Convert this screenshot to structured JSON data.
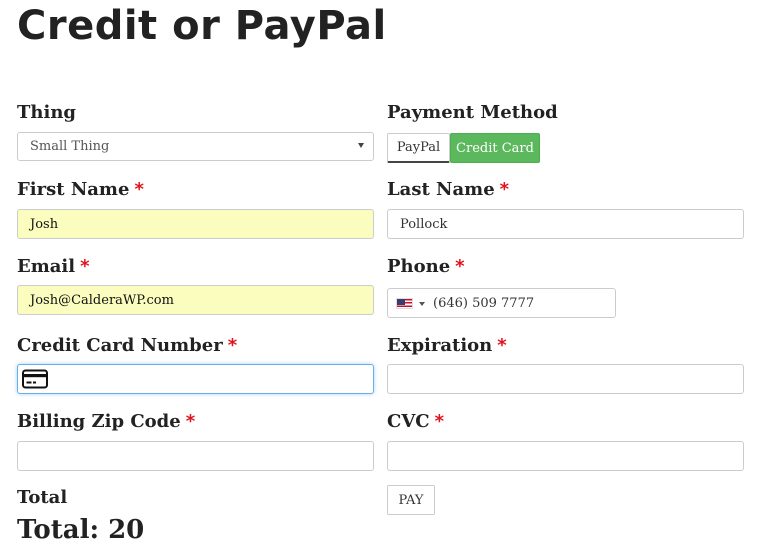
{
  "page": {
    "title": "Credit or PayPal"
  },
  "form": {
    "thing": {
      "label": "Thing",
      "selected": "Small Thing"
    },
    "payment_method": {
      "label": "Payment Method",
      "options": [
        "PayPal",
        "Credit Card"
      ],
      "selected": "Credit Card"
    },
    "first_name": {
      "label": "First Name",
      "required_mark": "*",
      "value": "Josh"
    },
    "last_name": {
      "label": "Last Name",
      "required_mark": "*",
      "value": "Pollock"
    },
    "email": {
      "label": "Email",
      "required_mark": "*",
      "value": "Josh@CalderaWP.com"
    },
    "phone": {
      "label": "Phone",
      "required_mark": "*",
      "value": "(646) 509 7777",
      "country_icon": "us-flag-icon"
    },
    "card_number": {
      "label": "Credit Card Number",
      "required_mark": "*",
      "value": "",
      "icon": "credit-card-icon"
    },
    "expiration": {
      "label": "Expiration",
      "required_mark": "*",
      "value": ""
    },
    "billing_zip": {
      "label": "Billing Zip Code",
      "required_mark": "*",
      "value": ""
    },
    "cvc": {
      "label": "CVC",
      "required_mark": "*",
      "value": ""
    },
    "pay_button": {
      "label": "PAY"
    },
    "total": {
      "label": "Total",
      "display": "Total: 20"
    }
  },
  "colors": {
    "autofill_bg": "#fbfdbe",
    "required": "#e0141e",
    "active_button": "#5cb85c",
    "focus_border": "#66afe9"
  }
}
